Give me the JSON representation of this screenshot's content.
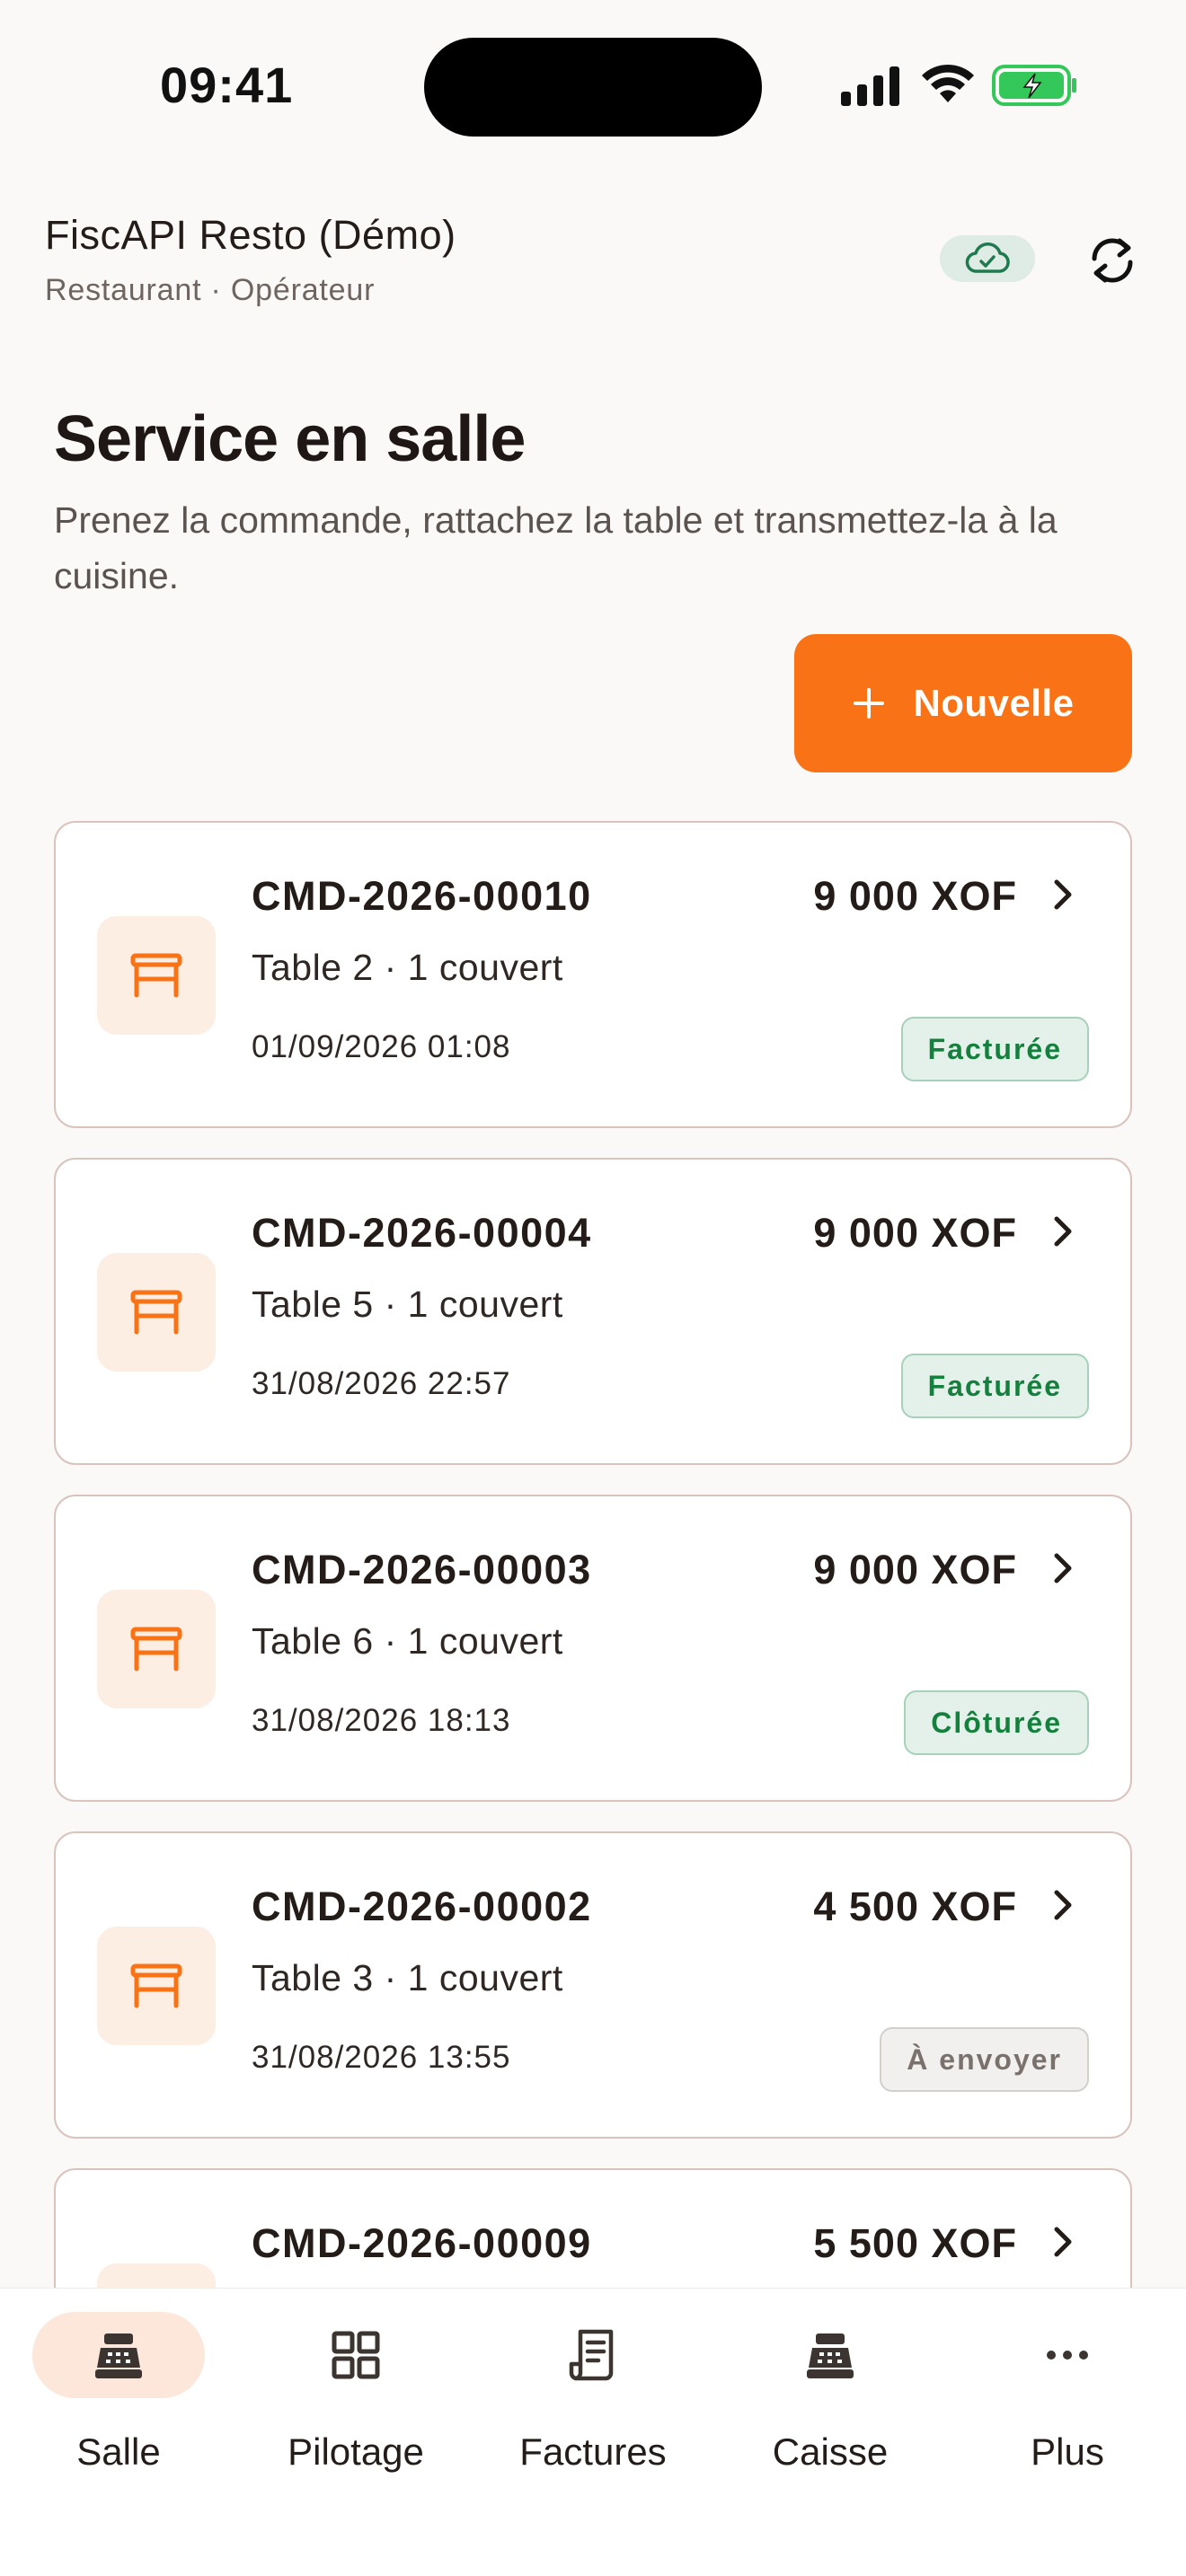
{
  "status_bar": {
    "time": "09:41"
  },
  "header": {
    "org_name": "FiscAPI Resto (Démo)",
    "org_subtitle": "Restaurant · Opérateur",
    "sync_icon": "cloud-check-icon",
    "refresh_icon": "refresh-icon"
  },
  "page": {
    "title": "Service en salle",
    "description": "Prenez la commande, rattachez la table et transmettez-la à la cuisine.",
    "new_button_label": "Nouvelle",
    "new_button_icon": "plus-icon"
  },
  "orders": [
    {
      "id": "CMD-2026-00010",
      "amount": "9 000 XOF",
      "table": "Table 2 · 1 couvert",
      "date": "01/09/2026 01:08",
      "status": "Facturée"
    },
    {
      "id": "CMD-2026-00004",
      "amount": "9 000 XOF",
      "table": "Table 5 · 1 couvert",
      "date": "31/08/2026 22:57",
      "status": "Facturée"
    },
    {
      "id": "CMD-2026-00003",
      "amount": "9 000 XOF",
      "table": "Table 6 · 1 couvert",
      "date": "31/08/2026 18:13",
      "status": "Clôturée"
    },
    {
      "id": "CMD-2026-00002",
      "amount": "4 500 XOF",
      "table": "Table 3 · 1 couvert",
      "date": "31/08/2026 13:55",
      "status": "À envoyer"
    },
    {
      "id": "CMD-2026-00009",
      "amount": "5 500 XOF",
      "table": "",
      "date": "",
      "status": ""
    }
  ],
  "nav": {
    "items": [
      {
        "label": "Salle",
        "icon": "cash-register-icon",
        "active": true
      },
      {
        "label": "Pilotage",
        "icon": "grid-icon",
        "active": false
      },
      {
        "label": "Factures",
        "icon": "receipt-icon",
        "active": false
      },
      {
        "label": "Caisse",
        "icon": "cash-register-icon",
        "active": false
      },
      {
        "label": "Plus",
        "icon": "more-icon",
        "active": false
      }
    ]
  },
  "colors": {
    "accent": "#f97316",
    "background": "#faf9f7",
    "success": "#15803d",
    "card_border": "#d9c4bd"
  }
}
